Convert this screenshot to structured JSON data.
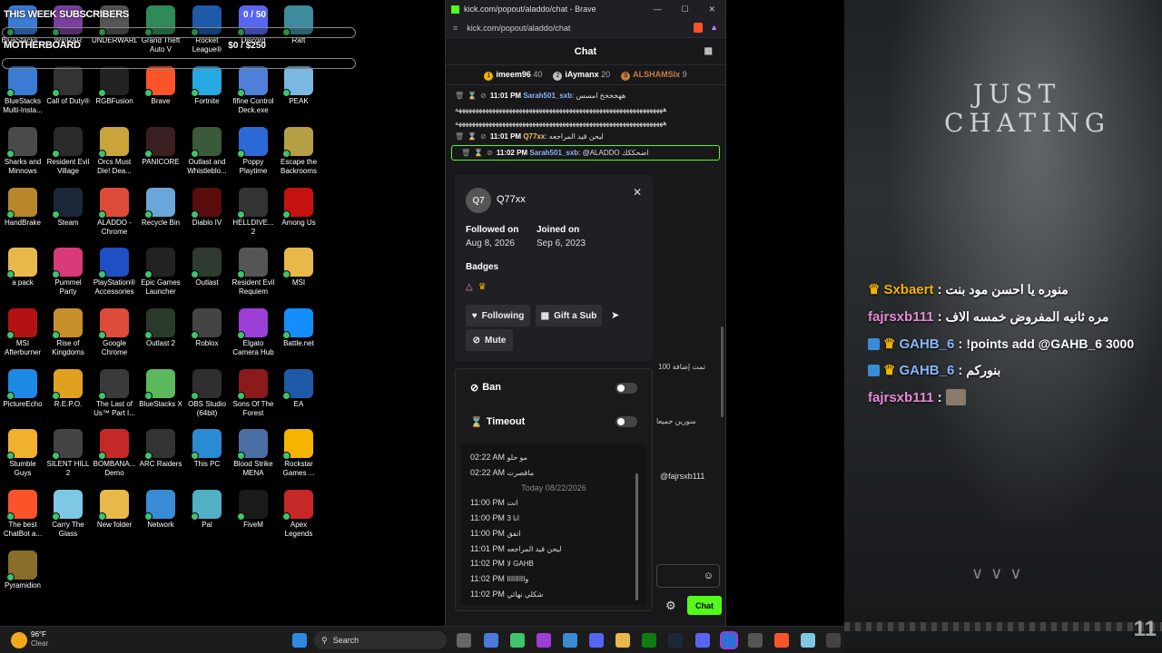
{
  "overlay": {
    "subs_title": "THIS WEEK SUBSCRIBERS",
    "subs_value": "0 / 50",
    "board_title": "MOTHERBOARD",
    "board_value": "$0 / $250"
  },
  "desktop_icons": [
    {
      "label": "BlueStacks...",
      "color": "#3a7bd5"
    },
    {
      "label": "WinRAR",
      "color": "#7b3fa0"
    },
    {
      "label": "UNDERWARD",
      "color": "#555"
    },
    {
      "label": "Grand Theft Auto V",
      "color": "#2e8b57"
    },
    {
      "label": "Rocket League®",
      "color": "#1e5aa8"
    },
    {
      "label": "Discord",
      "color": "#5865f2"
    },
    {
      "label": "Raft",
      "color": "#3d8b9c"
    },
    {
      "label": "BlueStacks Multi-Insta...",
      "color": "#3a7bd5"
    },
    {
      "label": "Call of Duty®",
      "color": "#333"
    },
    {
      "label": "RGBFusion",
      "color": "#222"
    },
    {
      "label": "Brave",
      "color": "#fb542b"
    },
    {
      "label": "Fortnite",
      "color": "#27a9e1"
    },
    {
      "label": "fifine Control Deck.exe",
      "color": "#4f7fd8"
    },
    {
      "label": "PEAK",
      "color": "#7ab8e0"
    },
    {
      "label": "Sharks and Minnows",
      "color": "#4a4a4a"
    },
    {
      "label": "Resident Evil Village",
      "color": "#2a2a2a"
    },
    {
      "label": "Orcs Must Die! Dea...",
      "color": "#c9a43a"
    },
    {
      "label": "PANICORE",
      "color": "#3a2020"
    },
    {
      "label": "Outlast and Whistleblo...",
      "color": "#3a5a3a"
    },
    {
      "label": "Poppy Playtime",
      "color": "#2b6ad6"
    },
    {
      "label": "Escape the Backrooms",
      "color": "#b5a046"
    },
    {
      "label": "HandBrake",
      "color": "#b8862b"
    },
    {
      "label": "Steam",
      "color": "#1b2838"
    },
    {
      "label": "ALADDO - Chrome",
      "color": "#dd4b39"
    },
    {
      "label": "Recycle Bin",
      "color": "#6aa7d8"
    },
    {
      "label": "Diablo IV",
      "color": "#5a0d0d"
    },
    {
      "label": "HELLDIVE... 2",
      "color": "#333"
    },
    {
      "label": "Among Us",
      "color": "#c51111"
    },
    {
      "label": "a pack",
      "color": "#e8b84a"
    },
    {
      "label": "Pummel Party",
      "color": "#d83a7a"
    },
    {
      "label": "PlayStation® Accessories",
      "color": "#1f4fc4"
    },
    {
      "label": "Epic Games Launcher",
      "color": "#222"
    },
    {
      "label": "Outlast",
      "color": "#2e3b2e"
    },
    {
      "label": "Resident Evil Requiem",
      "color": "#555"
    },
    {
      "label": "MSI",
      "color": "#e8b84a"
    },
    {
      "label": "MSI Afterburner",
      "color": "#b31212"
    },
    {
      "label": "Rise of Kingdoms",
      "color": "#c8902a"
    },
    {
      "label": "Google Chrome",
      "color": "#dd4b39"
    },
    {
      "label": "Outlast 2",
      "color": "#2a3a2a"
    },
    {
      "label": "Roblox",
      "color": "#444"
    },
    {
      "label": "Elgato Camera Hub",
      "color": "#9b3fd6"
    },
    {
      "label": "Battle.net",
      "color": "#148eff"
    },
    {
      "label": "PictureEcho",
      "color": "#1e88e5"
    },
    {
      "label": "R.E.P.O.",
      "color": "#e0a020"
    },
    {
      "label": "The Last of Us™ Part I...",
      "color": "#3a3a3a"
    },
    {
      "label": "BlueStacks X",
      "color": "#5cb85c"
    },
    {
      "label": "OBS Studio (64bit)",
      "color": "#302e31"
    },
    {
      "label": "Sons Of The Forest",
      "color": "#8b1a1a"
    },
    {
      "label": "EA",
      "color": "#1e5aa8"
    },
    {
      "label": "Stumble Guys",
      "color": "#f0b030"
    },
    {
      "label": "SILENT HILL 2",
      "color": "#444"
    },
    {
      "label": "BOMBANA... Demo",
      "color": "#c62828"
    },
    {
      "label": "ARC Raiders",
      "color": "#333"
    },
    {
      "label": "This PC",
      "color": "#2a8bd5"
    },
    {
      "label": "Blood Strike MENA",
      "color": "#4a6fa5"
    },
    {
      "label": "Rockstar Games ...",
      "color": "#f4b400"
    },
    {
      "label": "The best ChatBot a...",
      "color": "#fb542b"
    },
    {
      "label": "Carry The Glass",
      "color": "#7ec8e3"
    },
    {
      "label": "New folder",
      "color": "#e8b84a"
    },
    {
      "label": "Network",
      "color": "#3a8bd5"
    },
    {
      "label": "Pal",
      "color": "#4fb0c6"
    },
    {
      "label": "FiveM",
      "color": "#1a1a1a"
    },
    {
      "label": "Apex Legends",
      "color": "#c62828"
    },
    {
      "label": "Pyramidion",
      "color": "#8a6d2a"
    }
  ],
  "weather": {
    "temp": "96°F",
    "cond": "Clear"
  },
  "taskbar": {
    "search_label": "Search"
  },
  "browser": {
    "title": "kick.com/popout/aladdo/chat - Brave",
    "url": "kick.com/popout/aladdo/chat",
    "chat_title": "Chat",
    "leaders": [
      {
        "rank": "1",
        "name": "imeem96",
        "count": "40",
        "color": "#f2b300"
      },
      {
        "rank": "2",
        "name": "iAymanx",
        "count": "20",
        "color": "#bfbfbf"
      },
      {
        "rank": "3",
        "name": "ALSHAMSIx",
        "count": "9",
        "color": "#c77d3a"
      }
    ],
    "messages": [
      {
        "time": "11:01 PM",
        "user": "Sarah501_sxb",
        "user_color": "#8ab4f8",
        "text": "ههخخخخ امسس"
      },
      {
        "time": "",
        "user": "",
        "user_color": "#fff",
        "text": "ههههههههههههههههههههههههههههههههههههههههههههههههههههههههههههههه"
      },
      {
        "time": "",
        "user": "",
        "user_color": "#fff",
        "text": "ههههههههههههههههههههههههههههههههههههههههههههههههههههههههههههههه"
      },
      {
        "time": "11:01 PM",
        "user": "Q77xx",
        "user_color": "#f2c94c",
        "text": "ليحن قيد المراجعه"
      },
      {
        "time": "11:02 PM",
        "user": "Sarah501_sxb",
        "user_color": "#8ab4f8",
        "text": "@ALADDO اضحككك"
      }
    ],
    "send_label": "Chat",
    "side_texts": [
      "تمت إضافة 100",
      "منورين جميعا",
      "@fajrsxb111"
    ]
  },
  "usercard": {
    "initials": "Q7",
    "username": "Q77xx",
    "followed_label": "Followed on",
    "followed_date": "Aug 8, 2026",
    "joined_label": "Joined on",
    "joined_date": "Sep 6, 2023",
    "badges_label": "Badges",
    "following_label": "Following",
    "gift_label": "Gift a Sub",
    "mute_label": "Mute"
  },
  "moderation": {
    "ban_label": "Ban",
    "timeout_label": "Timeout",
    "history": [
      {
        "time": "02:22 AM",
        "text": "مو حلو"
      },
      {
        "time": "02:22 AM",
        "text": "ماقصرت"
      },
      {
        "divider": "Today 08/22/2026"
      },
      {
        "time": "11:00 PM",
        "text": "انت"
      },
      {
        "time": "11:00 PM",
        "text": "انا 3"
      },
      {
        "time": "11:00 PM",
        "text": "اتفق"
      },
      {
        "time": "11:01 PM",
        "text": "ليحن قيد المراجعه"
      },
      {
        "time": "11:02 PM",
        "text": "لا GAHB"
      },
      {
        "time": "11:02 PM",
        "text": "وااااااااا"
      },
      {
        "time": "11:02 PM",
        "text": "شكلي نهائي"
      }
    ]
  },
  "stream": {
    "title_line1": "JUST",
    "title_line2": "CHATING",
    "chat": [
      {
        "name": "Sxbaert",
        "name_color": "#f2b300",
        "text": "منوره يا احسن مود بنت",
        "badges": "crown"
      },
      {
        "name": "fajrsxb111",
        "name_color": "#e88bd4",
        "text": "مره ثانيه المفروض خمسه الاف",
        "badges": ""
      },
      {
        "name": "GAHB_6",
        "name_color": "#8ab4f8",
        "text": "!points add @GAHB_6 3000",
        "badges": "sword-crown"
      },
      {
        "name": "GAHB_6",
        "name_color": "#8ab4f8",
        "text": "بنوركم",
        "badges": "sword-crown"
      },
      {
        "name": "fajrsxb111",
        "name_color": "#e88bd4",
        "text": "",
        "badges": ""
      }
    ],
    "corner_number": "11"
  },
  "colors": {
    "kick_green": "#53fc18",
    "chat_bg": "#18181b"
  }
}
